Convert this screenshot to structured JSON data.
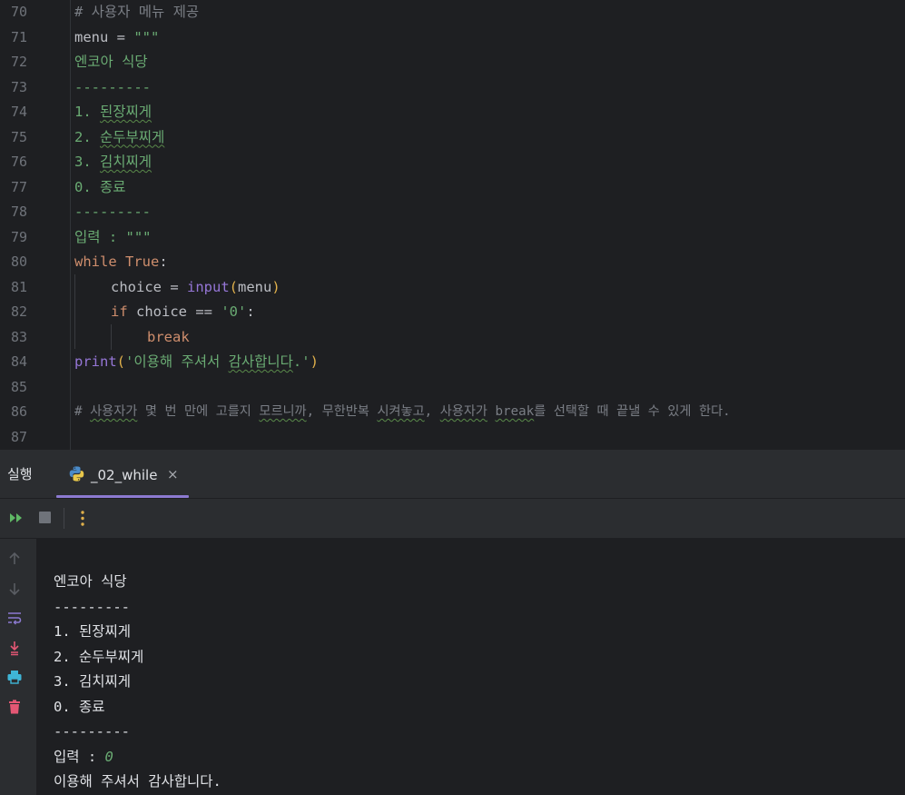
{
  "editor": {
    "line_numbers": [
      "70",
      "71",
      "72",
      "73",
      "74",
      "75",
      "76",
      "77",
      "78",
      "79",
      "80",
      "81",
      "82",
      "83",
      "84",
      "85",
      "86",
      "87"
    ],
    "lines": {
      "l70": "# 사용자 메뉴 제공",
      "l71_var": "menu",
      "l71_op": " = ",
      "l71_str": "\"\"\"",
      "l72": "엔코아 식당",
      "l73": "---------",
      "l74_num": "1. ",
      "l74_item": "된장찌게",
      "l75_num": "2. ",
      "l75_item": "순두부찌게",
      "l76_num": "3. ",
      "l76_item": "김치찌게",
      "l77": "0. 종료",
      "l78": "---------",
      "l79": "입력 : \"\"\"",
      "l80_kw": "while",
      "l80_true": "True",
      "l80_colon": ":",
      "l81_var": "choice",
      "l81_op": " = ",
      "l81_fn": "input",
      "l81_open": "(",
      "l81_arg": "menu",
      "l81_close": ")",
      "l82_kw": "if",
      "l82_var": " choice == ",
      "l82_str": "'0'",
      "l82_colon": ":",
      "l83_kw": "break",
      "l84_fn": "print",
      "l84_open": "(",
      "l84_str1": "'이용해 주셔서 ",
      "l84_str2": "감사합니다",
      "l84_str3": ".'",
      "l84_close": ")",
      "l86_a": "# ",
      "l86_b": "사용자가",
      "l86_c": " 몇 번 만에 고를지 ",
      "l86_d": "모르니까",
      "l86_e": ", 무한반복 ",
      "l86_f": "시켜놓고",
      "l86_g": ", ",
      "l86_h": "사용자가",
      "l86_i": " ",
      "l86_j": "break",
      "l86_k": "를 선택할 때 끝낼 수 있게 한다."
    }
  },
  "run_panel": {
    "title": "실행",
    "tab_label": "_02_while",
    "tab_close": "×",
    "toolbar": {
      "rerun_icon": "rerun-icon",
      "stop_icon": "stop-icon",
      "more_icon": "more-vertical-icon"
    },
    "side_icons": [
      "arrow-up-icon",
      "arrow-down-icon",
      "soft-wrap-icon",
      "scroll-to-end-icon",
      "print-icon",
      "trash-icon"
    ],
    "console_output": {
      "o1": "엔코아 식당",
      "o2": "---------",
      "o3": "1. 된장찌게",
      "o4": "2. 순두부찌게",
      "o5": "3. 김치찌게",
      "o6": "0. 종료",
      "o7": "---------",
      "o8_prompt": "입력 : ",
      "o8_input": "0",
      "o9": "이용해 주셔서 감사합니다."
    }
  },
  "colors": {
    "background": "#1e1f22",
    "panel": "#2b2d30",
    "keyword": "#cf8e6d",
    "string": "#6aab73",
    "function": "#9576d6",
    "comment": "#7a7e85",
    "accent": "#8c7ad1"
  }
}
